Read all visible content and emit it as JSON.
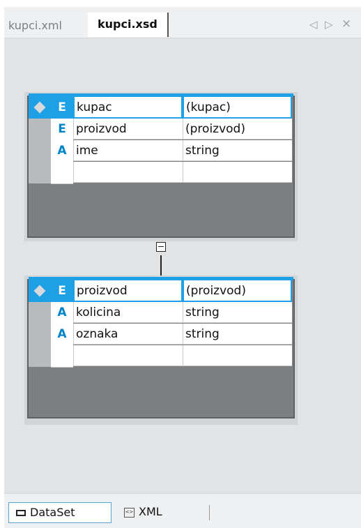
{
  "tabs": {
    "file1": "kupci.xml",
    "file2": "kupci.xsd",
    "nav_left": "◁",
    "nav_right": "▷",
    "nav_close": "×"
  },
  "tables": [
    {
      "header": {
        "key": "E",
        "name": "kupac",
        "type": "(kupac)"
      },
      "rows": [
        {
          "key": "E",
          "name": "proizvod",
          "type": "(proizvod)"
        },
        {
          "key": "A",
          "name": "ime",
          "type": "string"
        },
        {
          "key": "",
          "name": "",
          "type": ""
        }
      ]
    },
    {
      "header": {
        "key": "E",
        "name": "proizvod",
        "type": "(proizvod)"
      },
      "rows": [
        {
          "key": "A",
          "name": "kolicina",
          "type": "string"
        },
        {
          "key": "A",
          "name": "oznaka",
          "type": "string"
        },
        {
          "key": "",
          "name": "",
          "type": ""
        }
      ]
    }
  ],
  "bottom_tabs": {
    "dataset_label": "DataSet",
    "xml_label": "XML",
    "xml_icon_text": "<>"
  },
  "colors": {
    "accent": "#1ea0e6",
    "canvas": "#e1e3e5",
    "table_body": "#7d7f81"
  }
}
